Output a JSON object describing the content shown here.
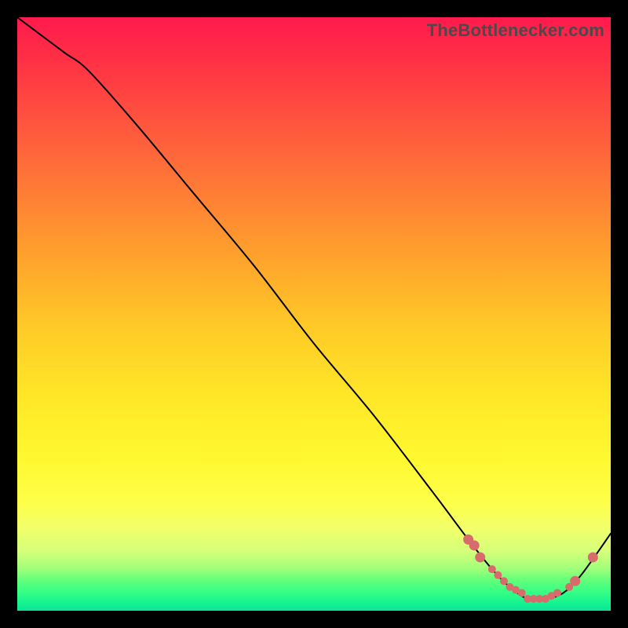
{
  "attribution": "TheBottlenecker.com",
  "colors": {
    "frame": "#000000",
    "curve": "#000000",
    "marker": "#d86b6b",
    "gradient_top": "#ff1a4d",
    "gradient_bottom": "#0de59a"
  },
  "chart_data": {
    "type": "line",
    "title": "",
    "xlabel": "",
    "ylabel": "",
    "xlim": [
      0,
      100
    ],
    "ylim": [
      0,
      100
    ],
    "grid": false,
    "axes_visible": false,
    "curve": {
      "x": [
        0,
        4,
        8,
        12,
        20,
        30,
        40,
        50,
        60,
        70,
        76,
        80,
        83,
        86,
        89,
        92,
        95,
        100
      ],
      "y": [
        100,
        97,
        94,
        91,
        82,
        70,
        58,
        45,
        33,
        20,
        12,
        7,
        4,
        2,
        2,
        3,
        6,
        13
      ]
    },
    "markers": {
      "comment": "approximate x positions (same ylim scale) of salmon dots along the trough and right upslope; y values taken from the curve at those x",
      "x": [
        76,
        77,
        78,
        80,
        81,
        82,
        83,
        84,
        85,
        86,
        87,
        88,
        89,
        90,
        91,
        93,
        94,
        97
      ],
      "y": [
        12,
        11,
        9,
        7,
        6,
        5,
        4,
        3.5,
        3,
        2,
        2,
        2,
        2,
        2.5,
        3,
        4,
        5,
        9
      ]
    }
  }
}
